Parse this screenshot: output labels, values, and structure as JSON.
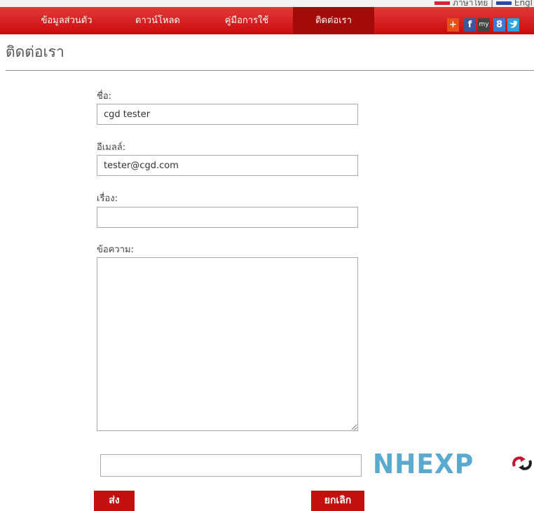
{
  "top_bar": {
    "lang_thai_label": "ภาษาไทย",
    "lang_divider": "|",
    "lang_english_label": "Engl"
  },
  "nav": {
    "items": [
      {
        "label": "ข้อมูลส่วนตัว"
      },
      {
        "label": "ดาวน์โหลด"
      },
      {
        "label": "คู่มือการใช้"
      },
      {
        "label": "ติดต่อเรา",
        "active": true
      }
    ]
  },
  "social": [
    {
      "name": "plus-icon",
      "glyph": "+",
      "color": "#e8501a"
    },
    {
      "name": "facebook-icon",
      "glyph": "f",
      "color": "#3b5998"
    },
    {
      "name": "myspace-icon",
      "glyph": "my",
      "color": "#444444"
    },
    {
      "name": "google-plus-icon",
      "glyph": "8",
      "color": "#3c7dd4"
    },
    {
      "name": "twitter-icon",
      "glyph": "t",
      "color": "#2aa3e0"
    }
  ],
  "page": {
    "title": "ติดต่อเรา"
  },
  "form": {
    "name_label": "ชื่อ:",
    "name_value": "cgd tester",
    "email_label": "อีเมลล์:",
    "email_value": "tester@cgd.com",
    "subject_label": "เรื่อง:",
    "subject_value": "",
    "message_label": "ข้อความ:",
    "message_value": "",
    "captcha_text": "NHEXP",
    "captcha_value": "",
    "submit_label": "ส่ง",
    "cancel_label": "ยกเลิก"
  },
  "colors": {
    "nav_red": "#d01a1a",
    "nav_active": "#a30b0b",
    "button_red": "#c40f0f",
    "captcha_blue": "#5aa9cf"
  }
}
